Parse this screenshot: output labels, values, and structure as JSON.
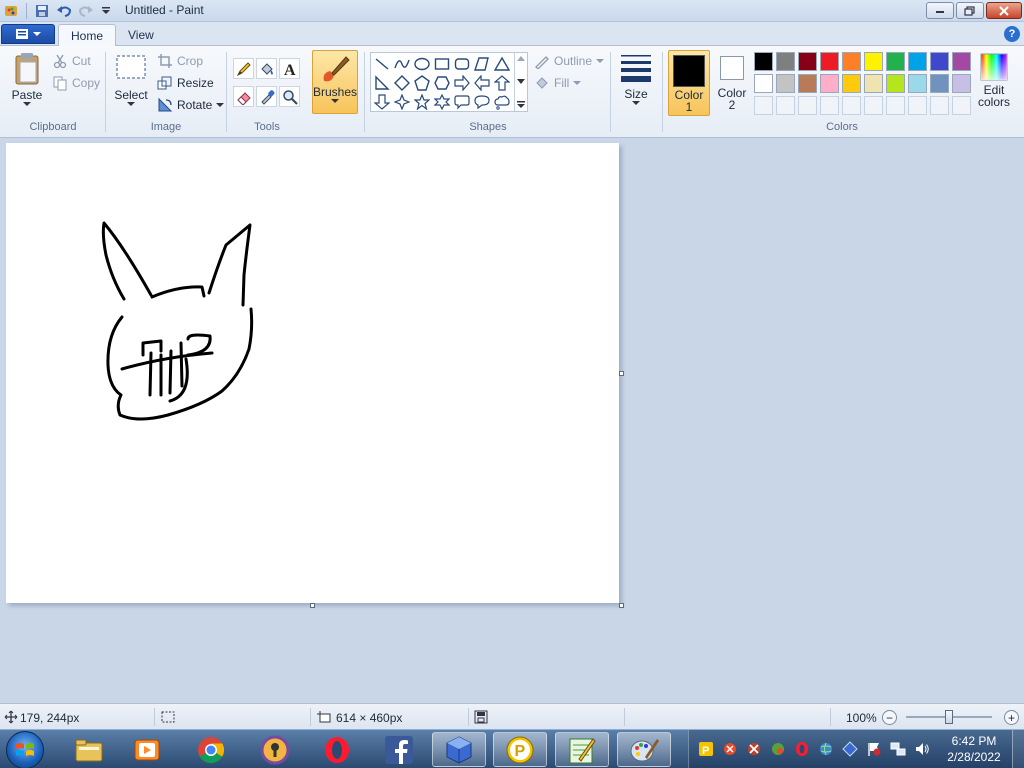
{
  "window": {
    "title": "Untitled - Paint"
  },
  "menu": {
    "tabs": [
      "Home",
      "View"
    ]
  },
  "clipboard": {
    "paste": "Paste",
    "cut": "Cut",
    "copy": "Copy",
    "label": "Clipboard"
  },
  "image": {
    "select": "Select",
    "crop": "Crop",
    "resize": "Resize",
    "rotate": "Rotate",
    "label": "Image"
  },
  "tools": {
    "label": "Tools"
  },
  "brushes": {
    "label": "Brushes"
  },
  "shapes": {
    "outline": "Outline",
    "fill": "Fill",
    "label": "Shapes"
  },
  "size": {
    "label": "Size"
  },
  "color1": {
    "line1": "Color",
    "line2": "1",
    "value": "#000000"
  },
  "color2": {
    "line1": "Color",
    "line2": "2",
    "value": "#ffffff"
  },
  "colors": {
    "label": "Colors",
    "edit_line1": "Edit",
    "edit_line2": "colors",
    "row1": [
      "#000000",
      "#7f7f7f",
      "#880015",
      "#ed1c24",
      "#ff7f27",
      "#fff200",
      "#22b14c",
      "#00a2e8",
      "#3f48cc",
      "#a349a4"
    ],
    "row2": [
      "#ffffff",
      "#c3c3c3",
      "#b97a57",
      "#ffaec9",
      "#ffc90e",
      "#efe4b0",
      "#b5e61d",
      "#99d9ea",
      "#7092be",
      "#c8bfe7"
    ],
    "row3": [
      "#f0f4f9",
      "#f0f4f9",
      "#f0f4f9",
      "#f0f4f9",
      "#f0f4f9",
      "#f0f4f9",
      "#f0f4f9",
      "#f0f4f9",
      "#f0f4f9",
      "#f0f4f9"
    ]
  },
  "status": {
    "cursor": "179, 244px",
    "image_size": "614 × 460px",
    "zoom": "100%",
    "zoom_minus": "−",
    "zoom_plus": "+"
  },
  "taskbar": {
    "apps": [
      "explorer-icon",
      "media-player-icon",
      "chrome-icon",
      "keepass-icon",
      "opera-icon",
      "facebook-icon",
      "virtualbox-icon",
      "plex-icon",
      "notepad-icon",
      "paint-icon"
    ],
    "time": "6:42 PM",
    "date": "2/28/2022"
  }
}
